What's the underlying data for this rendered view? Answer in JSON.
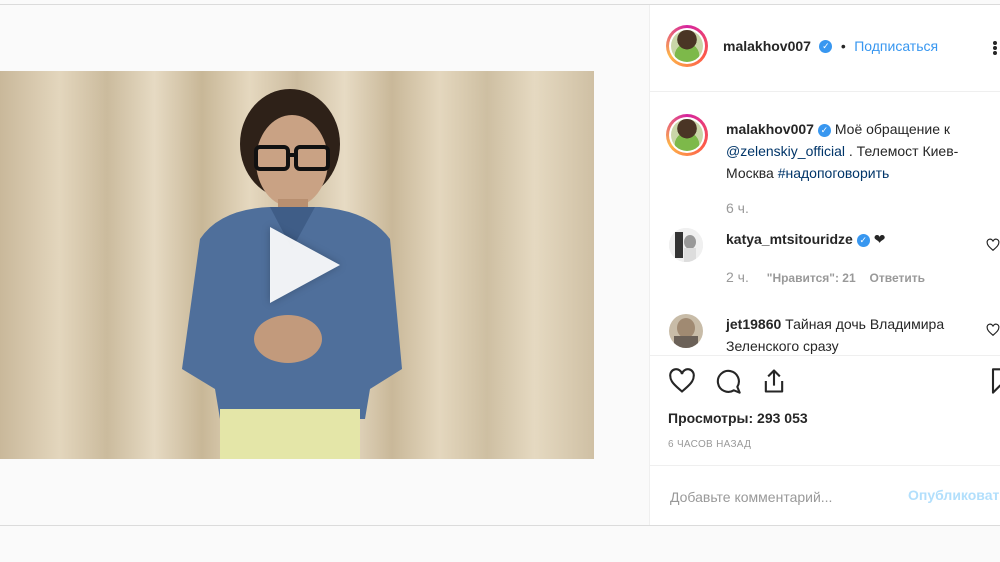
{
  "post": {
    "header": {
      "username": "malakhov007",
      "separator": "•",
      "follow_label": "Подписаться",
      "menu_icon": "more-icon"
    },
    "caption": {
      "username": "malakhov007",
      "text_1": "Моё обращение к",
      "mention": "@zelenskiy_official",
      "text_2": ". Телемост Киев-Москва",
      "hashtag": "#надопоговорить",
      "time": "6 ч."
    },
    "comments": [
      {
        "username": "katya_mtsitouridze",
        "text": "❤",
        "time": "2 ч.",
        "likes": "\"Нравится\": 21",
        "reply_label": "Ответить"
      },
      {
        "username": "jet19860",
        "text_1": "Тайная дочь",
        "text_2": "Владимира Зеленского сразу"
      }
    ],
    "stats": {
      "views_label": "Просмотры: 293 053",
      "time_ago": "6 ЧАСОВ НАЗАД"
    },
    "comment_box": {
      "placeholder": "Добавьте комментарий...",
      "publish_label": "Опубликовать"
    },
    "icons": {
      "like": "heart-icon",
      "comment": "comment-icon",
      "share": "share-icon",
      "save": "bookmark-icon",
      "play": "play-icon"
    },
    "colors": {
      "accent": "#3897f0",
      "link": "#003569",
      "muted": "#999999"
    }
  }
}
